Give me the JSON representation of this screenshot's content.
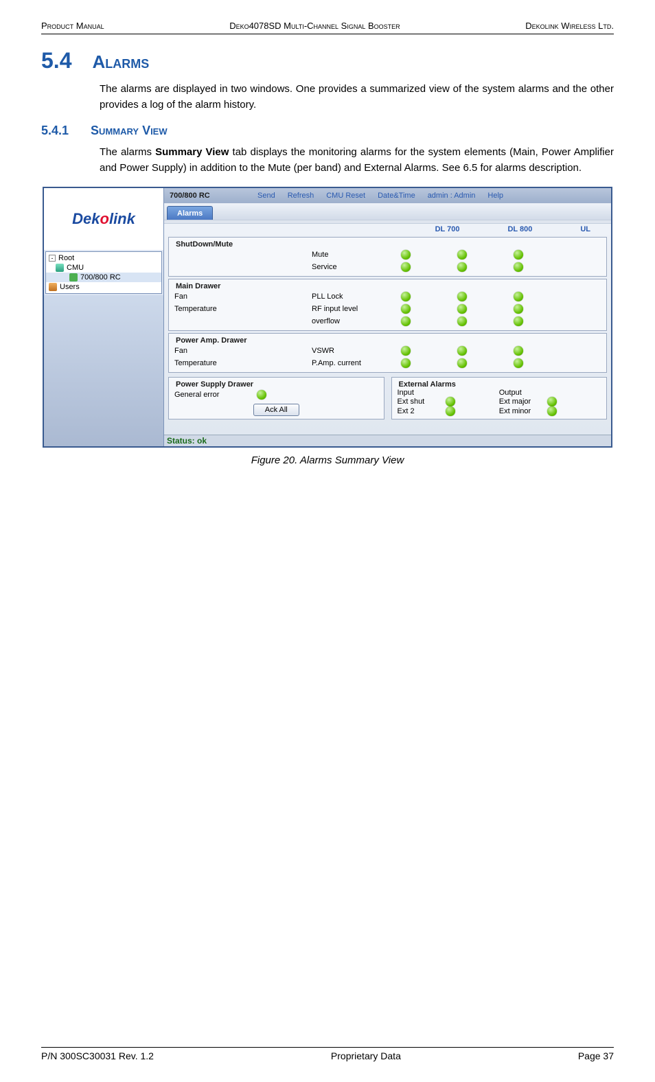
{
  "header": {
    "left": "Product Manual",
    "center": "Deko4078SD Multi-Channel Signal Booster",
    "right": "Dekolink Wireless Ltd."
  },
  "section": {
    "num": "5.4",
    "title": "Alarms",
    "intro": "The alarms are displayed in two windows. One provides a summarized view of the system alarms and the other provides a log of the alarm history."
  },
  "subsection": {
    "num": "5.4.1",
    "title": "Summary View",
    "text_a": "The alarms ",
    "text_bold": "Summary View",
    "text_b": " tab displays the monitoring alarms for the system elements (Main, Power Amplifier and Power Supply) in addition to the Mute (per band) and External Alarms. See 6.5 for alarms description."
  },
  "caption": "Figure 20. Alarms Summary View",
  "footer": {
    "left": "P/N 300SC30031 Rev. 1.2",
    "center": "Proprietary Data",
    "right": "Page 37"
  },
  "app": {
    "logo_prefix": "Dek",
    "logo_o": "o",
    "logo_suffix": "link",
    "tree": {
      "root": "Root",
      "cmu": "CMU",
      "rc": "700/800 RC",
      "users": "Users"
    },
    "topbar": {
      "title": "700/800 RC",
      "send": "Send",
      "refresh": "Refresh",
      "reset": "CMU Reset",
      "dt": "Date&Time",
      "auth": "admin : Admin",
      "help": "Help"
    },
    "tab_alarms": "Alarms",
    "cols": {
      "c1": "DL 700",
      "c2": "DL 800",
      "c3": "UL"
    },
    "g_shutdown": {
      "legend": "ShutDown/Mute",
      "mute": "Mute",
      "service": "Service"
    },
    "g_main": {
      "legend": "Main Drawer",
      "fan": "Fan",
      "temp": "Temperature",
      "pll": "PLL Lock",
      "rf": "RF input level",
      "ovr": "overflow"
    },
    "g_pa": {
      "legend": "Power Amp. Drawer",
      "fan": "Fan",
      "temp": "Temperature",
      "vswr": "VSWR",
      "pac": "P.Amp. current"
    },
    "g_ps": {
      "legend": "Power Supply Drawer",
      "gen": "General error",
      "ack": "Ack All"
    },
    "g_ext": {
      "legend": "External Alarms",
      "input": "Input",
      "output": "Output",
      "es": "Ext shut",
      "emaj": "Ext major",
      "e2": "Ext 2",
      "emin": "Ext minor"
    },
    "status": "Status: ok"
  }
}
